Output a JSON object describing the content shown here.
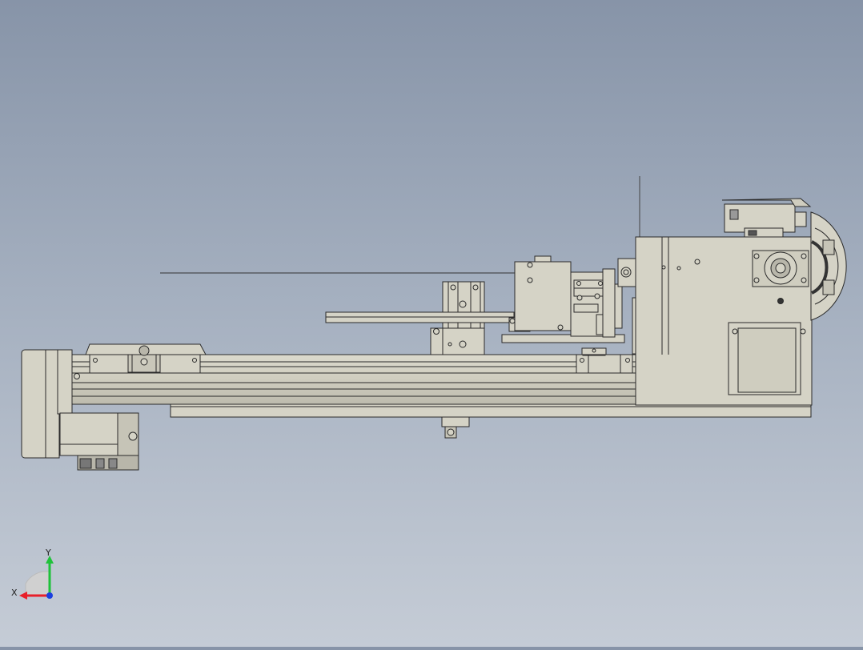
{
  "viewport": {
    "background_top": "#8794a8",
    "background_bottom": "#c5ccd6",
    "part_fill": "#d5d3c6",
    "part_shade": "#b9b7aa",
    "edge_color": "#2a2a2a"
  },
  "triad": {
    "x_label": "X",
    "y_label": "Y",
    "x_color": "#e8202a",
    "y_color": "#1fc23a",
    "z_color": "#1a3fe0"
  }
}
